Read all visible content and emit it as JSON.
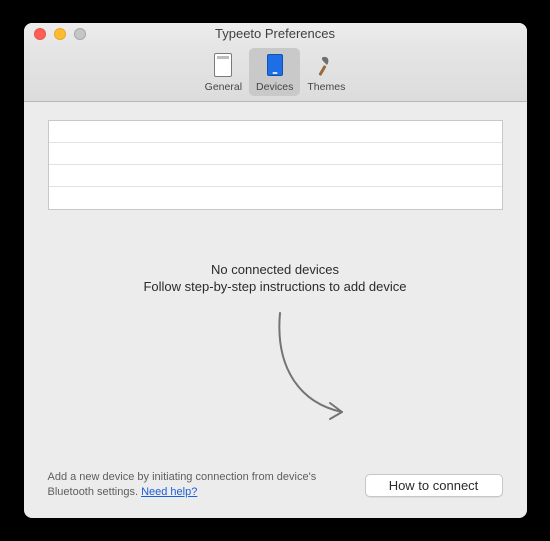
{
  "window": {
    "title": "Typeeto Preferences"
  },
  "tabs": {
    "general": {
      "label": "General"
    },
    "devices": {
      "label": "Devices",
      "selected": true
    },
    "themes": {
      "label": "Themes"
    }
  },
  "empty": {
    "line1": "No connected devices",
    "line2": "Follow step-by-step instructions to add device"
  },
  "hint": {
    "text": "Add a new device by initiating connection from device's Bluetooth settings. ",
    "link_label": "Need help?"
  },
  "button": {
    "how_to_connect": "How to connect"
  }
}
